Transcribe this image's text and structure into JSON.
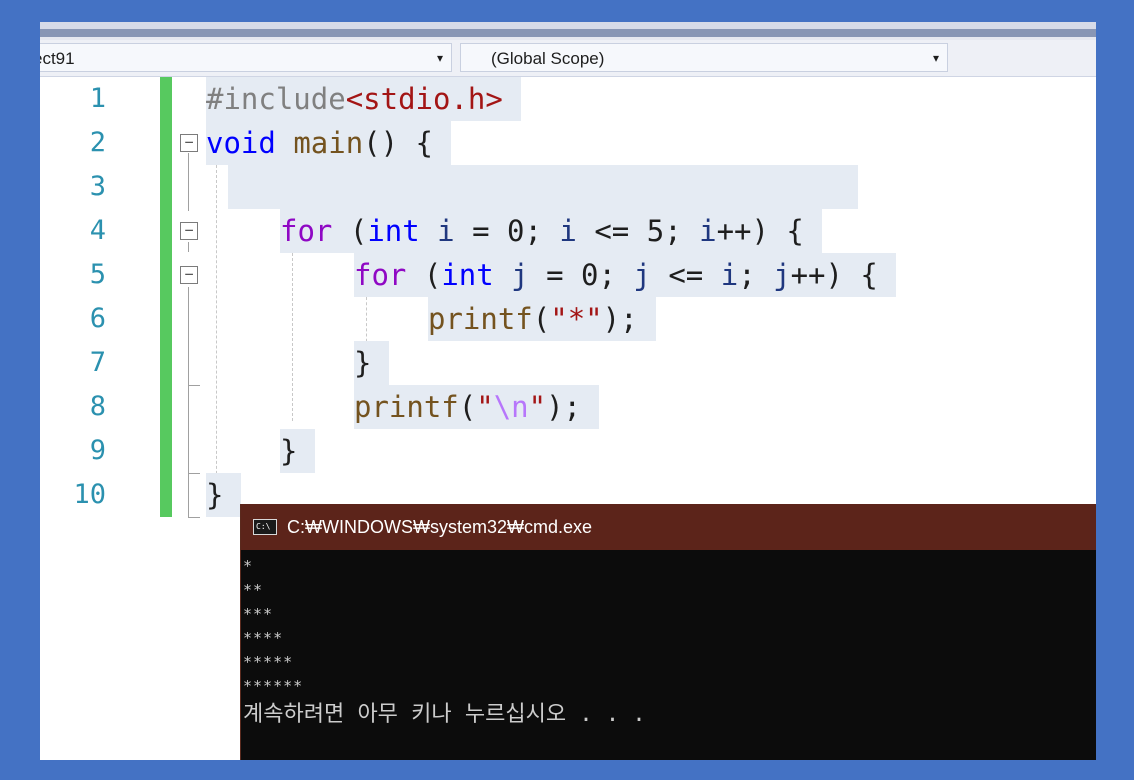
{
  "navbar": {
    "project_label": "ect91",
    "scope_label": "(Global Scope)",
    "dropdown_arrow": "▾"
  },
  "editor": {
    "line_numbers": [
      "1",
      "2",
      "3",
      "4",
      "5",
      "6",
      "7",
      "8",
      "9",
      "10"
    ],
    "lines": [
      {
        "parts": [
          {
            "t": "#include",
            "c": "kw-pre"
          },
          {
            "t": "<stdio.h>",
            "c": "str-inc"
          }
        ]
      },
      {
        "parts": [
          {
            "t": "void",
            "c": "kw"
          },
          {
            "t": " ",
            "c": ""
          },
          {
            "t": "main",
            "c": "fn"
          },
          {
            "t": "() {",
            "c": ""
          }
        ]
      },
      {
        "parts": [
          {
            "t": " ",
            "c": ""
          }
        ]
      },
      {
        "parts": [
          {
            "t": "for",
            "c": "kw-ctrl"
          },
          {
            "t": " (",
            "c": ""
          },
          {
            "t": "int",
            "c": "kw"
          },
          {
            "t": " ",
            "c": ""
          },
          {
            "t": "i",
            "c": "ident"
          },
          {
            "t": " = ",
            "c": ""
          },
          {
            "t": "0",
            "c": ""
          },
          {
            "t": "; ",
            "c": ""
          },
          {
            "t": "i",
            "c": "ident"
          },
          {
            "t": " <= ",
            "c": ""
          },
          {
            "t": "5",
            "c": ""
          },
          {
            "t": "; ",
            "c": ""
          },
          {
            "t": "i",
            "c": "ident"
          },
          {
            "t": "++) {",
            "c": ""
          }
        ]
      },
      {
        "parts": [
          {
            "t": "for",
            "c": "kw-ctrl"
          },
          {
            "t": " (",
            "c": ""
          },
          {
            "t": "int",
            "c": "kw"
          },
          {
            "t": " ",
            "c": ""
          },
          {
            "t": "j",
            "c": "ident"
          },
          {
            "t": " = ",
            "c": ""
          },
          {
            "t": "0",
            "c": ""
          },
          {
            "t": "; ",
            "c": ""
          },
          {
            "t": "j",
            "c": "ident"
          },
          {
            "t": " <= ",
            "c": ""
          },
          {
            "t": "i",
            "c": "ident"
          },
          {
            "t": "; ",
            "c": ""
          },
          {
            "t": "j",
            "c": "ident"
          },
          {
            "t": "++) {",
            "c": ""
          }
        ]
      },
      {
        "parts": [
          {
            "t": "printf",
            "c": "fn"
          },
          {
            "t": "(",
            "c": ""
          },
          {
            "t": "\"*\"",
            "c": "str"
          },
          {
            "t": ");",
            "c": ""
          }
        ]
      },
      {
        "parts": [
          {
            "t": "}",
            "c": ""
          }
        ]
      },
      {
        "parts": [
          {
            "t": "printf",
            "c": "fn"
          },
          {
            "t": "(",
            "c": ""
          },
          {
            "t": "\"",
            "c": "str"
          },
          {
            "t": "\\n",
            "c": "esc"
          },
          {
            "t": "\"",
            "c": "str"
          },
          {
            "t": ");",
            "c": ""
          }
        ]
      },
      {
        "parts": [
          {
            "t": "}",
            "c": ""
          }
        ]
      },
      {
        "parts": [
          {
            "t": "}",
            "c": ""
          }
        ]
      }
    ],
    "fold_symbol": "−"
  },
  "console": {
    "title": "C:₩WINDOWS₩system32₩cmd.exe",
    "icon_text": "C:\\",
    "output_lines": [
      "*",
      "**",
      "***",
      "****",
      "*****",
      "******"
    ],
    "prompt_message": "계속하려면 아무 키나 누르십시오 . . ."
  },
  "colors": {
    "background": "#4472c4",
    "change_bar": "#57c95f",
    "console_title_bar": "#5c241a",
    "line_number": "#2b91af"
  }
}
